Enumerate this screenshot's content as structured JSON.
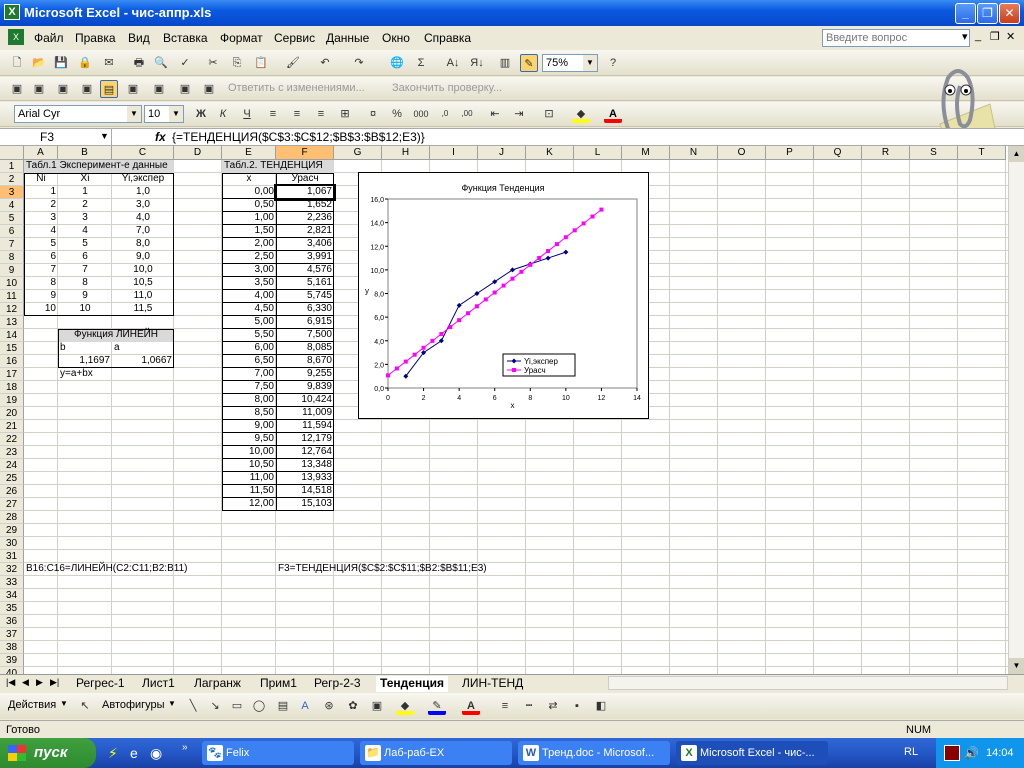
{
  "window": {
    "title": "Microsoft Excel - чис-аппр.xls"
  },
  "menu": [
    "Файл",
    "Правка",
    "Вид",
    "Вставка",
    "Формат",
    "Сервис",
    "Данные",
    "Окно",
    "Справка"
  ],
  "ask_placeholder": "Введите вопрос",
  "toolbar": {
    "zoom": "75%",
    "reply_changes": "Ответить с изменениями...",
    "end_review": "Закончить проверку...",
    "font": "Arial Cyr",
    "size": "10"
  },
  "formula": {
    "cell": "F3",
    "fx": "fx",
    "text": "{=ТЕНДЕНЦИЯ($C$3:$C$12;$B$3:$B$12;E3)}"
  },
  "columns": [
    "A",
    "B",
    "C",
    "D",
    "E",
    "F",
    "G",
    "H",
    "I",
    "J",
    "K",
    "L",
    "M",
    "N",
    "O",
    "P",
    "Q",
    "R",
    "S",
    "T"
  ],
  "rows": [
    "1",
    "2",
    "3",
    "4",
    "5",
    "6",
    "7",
    "8",
    "9",
    "10",
    "11",
    "12",
    "13",
    "14",
    "15",
    "16",
    "17",
    "18",
    "19",
    "20",
    "21",
    "22",
    "23",
    "24",
    "25",
    "26",
    "27",
    "28",
    "29",
    "30",
    "31",
    "32",
    "33",
    "34",
    "35",
    "36",
    "37",
    "38",
    "39",
    "40"
  ],
  "table1": {
    "title": "Табл.1 Эксперимент-е данные",
    "headers": [
      "Ni",
      "Xi",
      "Yi,экспер"
    ],
    "ni": [
      "1",
      "2",
      "3",
      "4",
      "5",
      "6",
      "7",
      "8",
      "9",
      "10"
    ],
    "xi": [
      "1",
      "2",
      "3",
      "4",
      "5",
      "6",
      "7",
      "8",
      "9",
      "10"
    ],
    "yi": [
      "1,0",
      "3,0",
      "4,0",
      "7,0",
      "8,0",
      "9,0",
      "10,0",
      "10,5",
      "11,0",
      "11,5"
    ]
  },
  "linest": {
    "title": "Функция ЛИНЕЙН",
    "b_label": "b",
    "a_label": "a",
    "b_val": "1,1697",
    "a_val": "1,0667",
    "eq": "y=a+bx"
  },
  "table2": {
    "title": "Табл.2. ТЕНДЕНЦИЯ",
    "headers": [
      "x",
      "Урасч"
    ],
    "x": [
      "0,00",
      "0,50",
      "1,00",
      "1,50",
      "2,00",
      "2,50",
      "3,00",
      "3,50",
      "4,00",
      "4,50",
      "5,00",
      "5,50",
      "6,00",
      "6,50",
      "7,00",
      "7,50",
      "8,00",
      "8,50",
      "9,00",
      "9,50",
      "10,00",
      "10,50",
      "11,00",
      "11,50",
      "12,00"
    ],
    "y": [
      "1,067",
      "1,652",
      "2,236",
      "2,821",
      "3,406",
      "3,991",
      "4,576",
      "5,161",
      "5,745",
      "6,330",
      "6,915",
      "7,500",
      "8,085",
      "8,670",
      "9,255",
      "9,839",
      "10,424",
      "11,009",
      "11,594",
      "12,179",
      "12,764",
      "13,348",
      "13,933",
      "14,518",
      "15,103"
    ]
  },
  "notes": {
    "r32a": "B16:C16=ЛИНЕЙН(C2:C11;B2:B11)",
    "r32b": "F3=ТЕНДЕНЦИЯ($C$2:$C$11;$B2:$B$11;E3)"
  },
  "sheets": [
    "Регрес-1",
    "Лист1",
    "Лагранж",
    "Прим1",
    "Регр-2-3",
    "Тенденция",
    "ЛИН-ТЕНД"
  ],
  "active_sheet": "Тенденция",
  "draw": {
    "actions": "Действия",
    "autoshapes": "Автофигуры"
  },
  "status": {
    "ready": "Готово",
    "num": "NUM"
  },
  "taskbar": {
    "start": "пуск",
    "tasks": [
      "Felix",
      "Лаб-раб-EX",
      "Тренд.doc - Microsof...",
      "Microsoft Excel - чис-..."
    ],
    "lang": "RL",
    "time": "14:04"
  },
  "chart_data": {
    "type": "scatter",
    "title": "Функция Тенденция",
    "xlabel": "x",
    "ylabel": "y",
    "xlim": [
      0,
      14
    ],
    "ylim": [
      0,
      16
    ],
    "xticks": [
      "0",
      "2",
      "4",
      "6",
      "8",
      "10",
      "12",
      "14"
    ],
    "yticks": [
      "0,0",
      "2,0",
      "4,0",
      "6,0",
      "8,0",
      "10,0",
      "12,0",
      "14,0",
      "16,0"
    ],
    "legend": "bottom-right",
    "series": [
      {
        "name": "Yi,экспер",
        "color": "#000080",
        "marker": "diamond",
        "x": [
          1,
          2,
          3,
          4,
          5,
          6,
          7,
          8,
          9,
          10
        ],
        "y": [
          1.0,
          3.0,
          4.0,
          7.0,
          8.0,
          9.0,
          10.0,
          10.5,
          11.0,
          11.5
        ]
      },
      {
        "name": "Урасч",
        "color": "#ff00ff",
        "marker": "square",
        "x": [
          0,
          0.5,
          1,
          1.5,
          2,
          2.5,
          3,
          3.5,
          4,
          4.5,
          5,
          5.5,
          6,
          6.5,
          7,
          7.5,
          8,
          8.5,
          9,
          9.5,
          10,
          10.5,
          11,
          11.5,
          12
        ],
        "y": [
          1.067,
          1.652,
          2.236,
          2.821,
          3.406,
          3.991,
          4.576,
          5.161,
          5.745,
          6.33,
          6.915,
          7.5,
          8.085,
          8.67,
          9.255,
          9.839,
          10.424,
          11.009,
          11.594,
          12.179,
          12.764,
          13.348,
          13.933,
          14.518,
          15.103
        ]
      }
    ]
  }
}
